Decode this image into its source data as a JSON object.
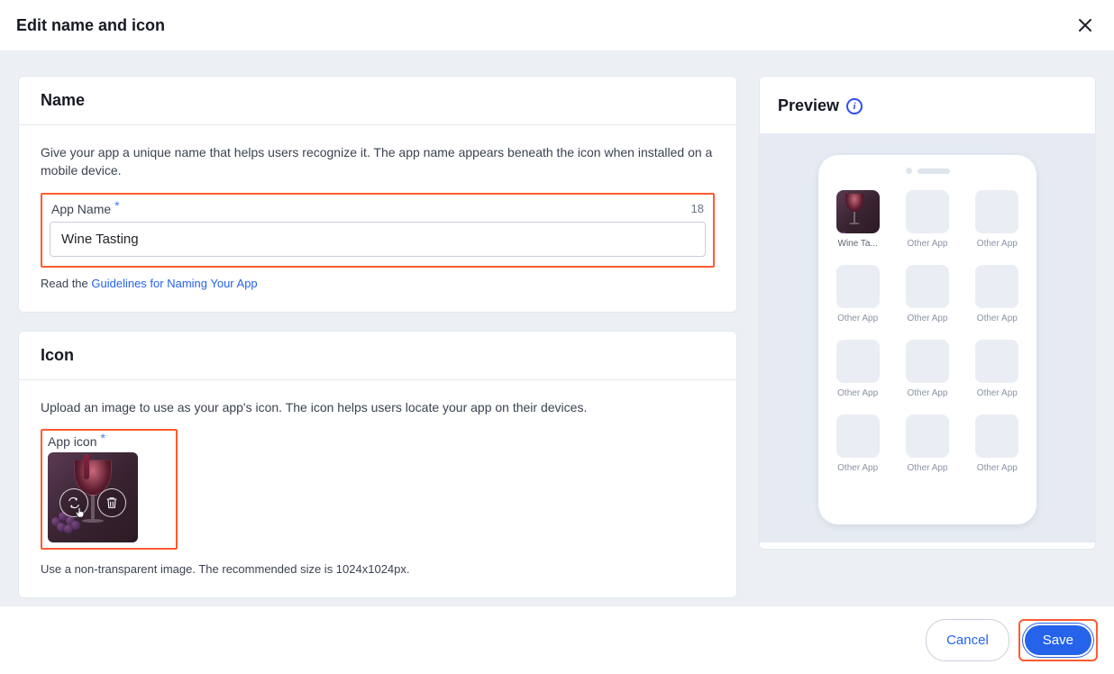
{
  "header": {
    "title": "Edit name and icon"
  },
  "name_section": {
    "heading": "Name",
    "description": "Give your app a unique name that helps users recognize it. The app name appears beneath the icon when installed on a mobile device.",
    "field_label": "App Name",
    "char_count": "18",
    "value": "Wine Tasting",
    "hint_prefix": "Read the ",
    "hint_link": "Guidelines for Naming Your App"
  },
  "icon_section": {
    "heading": "Icon",
    "description": "Upload an image to use as your app's icon. The icon helps users locate your app on their devices.",
    "field_label": "App icon",
    "hint": "Use a non-transparent image. The recommended size is 1024x1024px."
  },
  "preview": {
    "heading": "Preview",
    "app_label_truncated": "Wine Ta...",
    "other_label": "Other App"
  },
  "footer": {
    "cancel": "Cancel",
    "save": "Save"
  }
}
